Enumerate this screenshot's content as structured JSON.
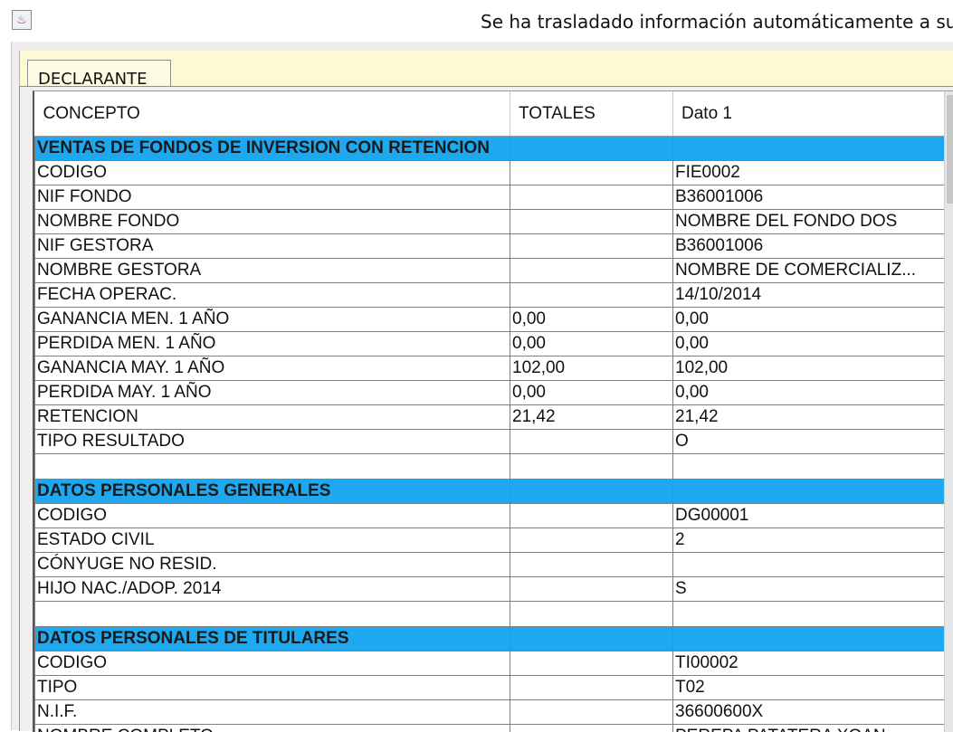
{
  "window": {
    "title": "Se ha trasladado información automáticamente a su de",
    "icon": "java-icon"
  },
  "tabs": [
    {
      "label": "DECLARANTE",
      "selected": true
    }
  ],
  "table": {
    "headers": [
      "CONCEPTO",
      "TOTALES",
      "Dato 1"
    ],
    "rows": [
      {
        "type": "section",
        "cells": [
          "VENTAS DE FONDOS DE INVERSION CON RETENCION",
          "",
          ""
        ]
      },
      {
        "type": "data",
        "cells": [
          "CODIGO",
          "",
          "FIE0002"
        ]
      },
      {
        "type": "data",
        "cells": [
          "NIF FONDO",
          "",
          "B36001006"
        ]
      },
      {
        "type": "data",
        "cells": [
          "NOMBRE FONDO",
          "",
          "NOMBRE DEL FONDO DOS"
        ]
      },
      {
        "type": "data",
        "cells": [
          "NIF GESTORA",
          "",
          "B36001006"
        ]
      },
      {
        "type": "data",
        "cells": [
          "NOMBRE GESTORA",
          "",
          "NOMBRE DE COMERCIALIZ..."
        ]
      },
      {
        "type": "data",
        "cells": [
          "FECHA OPERAC.",
          "",
          "14/10/2014"
        ]
      },
      {
        "type": "data",
        "cells": [
          "GANANCIA MEN. 1 AÑO",
          "0,00",
          "0,00"
        ]
      },
      {
        "type": "data",
        "cells": [
          "PERDIDA MEN. 1 AÑO",
          "0,00",
          "0,00"
        ]
      },
      {
        "type": "data",
        "cells": [
          "GANANCIA MAY. 1 AÑO",
          "102,00",
          "102,00"
        ]
      },
      {
        "type": "data",
        "cells": [
          "PERDIDA MAY. 1 AÑO",
          "0,00",
          "0,00"
        ]
      },
      {
        "type": "data",
        "cells": [
          "RETENCION",
          "21,42",
          "21,42"
        ]
      },
      {
        "type": "data",
        "cells": [
          "TIPO RESULTADO",
          "",
          "O"
        ]
      },
      {
        "type": "empty",
        "cells": [
          "",
          "",
          ""
        ]
      },
      {
        "type": "section",
        "cells": [
          "DATOS PERSONALES GENERALES",
          "",
          ""
        ]
      },
      {
        "type": "data",
        "cells": [
          "CODIGO",
          "",
          "DG00001"
        ]
      },
      {
        "type": "data",
        "cells": [
          "ESTADO CIVIL",
          "",
          "2"
        ]
      },
      {
        "type": "data",
        "cells": [
          "CÓNYUGE NO RESID.",
          "",
          ""
        ]
      },
      {
        "type": "data",
        "cells": [
          "HIJO NAC./ADOP. 2014",
          "",
          "S"
        ]
      },
      {
        "type": "empty",
        "cells": [
          "",
          "",
          ""
        ]
      },
      {
        "type": "section",
        "cells": [
          "DATOS PERSONALES DE TITULARES",
          "",
          ""
        ]
      },
      {
        "type": "data",
        "cells": [
          "CODIGO",
          "",
          "TI00002"
        ]
      },
      {
        "type": "data",
        "cells": [
          "TIPO",
          "",
          "T02"
        ]
      },
      {
        "type": "data",
        "cells": [
          "N.I.F.",
          "",
          "36600600X"
        ]
      },
      {
        "type": "data",
        "cells": [
          "NOMBRE COMPLETO",
          "",
          "PEREPA PATATERA XOAN"
        ]
      }
    ]
  },
  "colors": {
    "section_bg": "#1ea8ef",
    "tabstrip_bg": "#fbfad4",
    "grid_line": "#808080"
  }
}
